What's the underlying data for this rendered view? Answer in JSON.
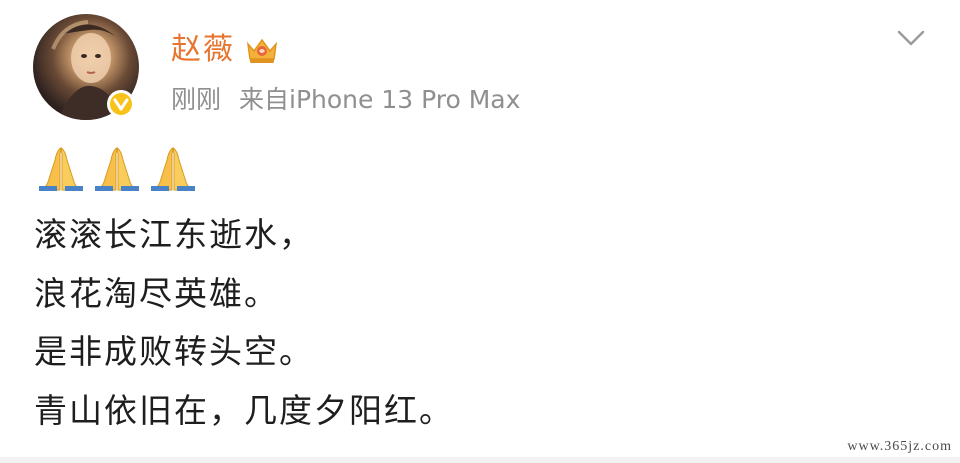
{
  "post": {
    "author": {
      "name": "赵薇",
      "avatar_icon": "avatar",
      "badge_icon": "verified-badge-icon",
      "badge_color": "#f8c21b",
      "vip_icon": "crown-icon",
      "name_color": "#e8752f"
    },
    "meta": {
      "time": "刚刚",
      "source": "来自iPhone 13 Pro Max"
    },
    "menu_icon": "chevron-down-icon",
    "emojis": [
      "pray-icon",
      "pray-icon",
      "pray-icon"
    ],
    "lines": [
      "滚滚长江东逝水，",
      "浪花淘尽英雄。",
      "是非成败转头空。",
      "青山依旧在，几度夕阳红。"
    ]
  },
  "watermark": "www.365jz.com"
}
